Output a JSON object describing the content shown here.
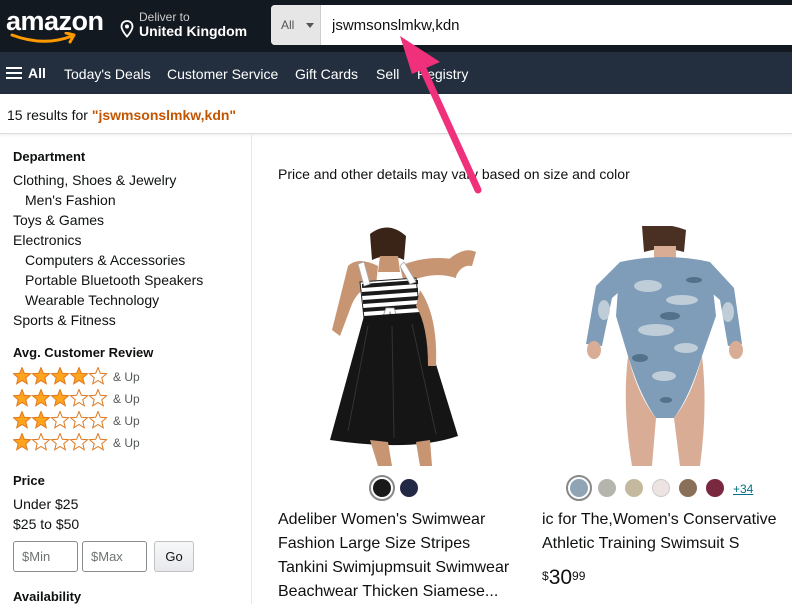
{
  "header": {
    "logo_text": "amazon",
    "deliver_to_label": "Deliver to",
    "deliver_to_location": "United Kingdom",
    "search": {
      "category": "All",
      "query": "jswmsonslmkw,kdn"
    }
  },
  "nav": {
    "all_label": "All",
    "items": [
      "Today's Deals",
      "Customer Service",
      "Gift Cards",
      "Sell",
      "Registry"
    ]
  },
  "results": {
    "prefix": "15 results for ",
    "query": "\"jswmsonslmkw,kdn\""
  },
  "sidebar": {
    "department_heading": "Department",
    "departments": [
      "Clothing, Shoes & Jewelry",
      "Men's Fashion",
      "Toys & Games",
      "Electronics",
      "Computers & Accessories",
      "Portable Bluetooth Speakers",
      "Wearable Technology",
      "Sports & Fitness"
    ],
    "review_heading": "Avg. Customer Review",
    "review_options": [
      {
        "stars": 4,
        "label": "& Up"
      },
      {
        "stars": 3,
        "label": "& Up"
      },
      {
        "stars": 2,
        "label": "& Up"
      },
      {
        "stars": 1,
        "label": "& Up"
      }
    ],
    "price_heading": "Price",
    "price_ranges": [
      "Under $25",
      "$25 to $50"
    ],
    "min_placeholder": "Min",
    "max_placeholder": "Max",
    "currency_symbol": "$",
    "go_label": "Go",
    "availability_heading": "Availability"
  },
  "main": {
    "notice": "Price and other details may vary based on size and color",
    "products": [
      {
        "title_lines": [
          "Adeliber Women's Swimwear",
          "Fashion Large Size Stripes",
          "Tankini Swimjupmsuit Swimwear",
          "Beachwear Thicken Siamese..."
        ],
        "swatches": [
          "#1a1a1a",
          "#232845"
        ],
        "selected_swatch": 0,
        "more_colors": "",
        "price_symbol": "",
        "price_whole": "",
        "price_fraction": ""
      },
      {
        "title_lines": [
          "ic for The,Women's Conservative",
          "Athletic Training Swimsuit S"
        ],
        "swatches": [
          "#8fa4b5",
          "#b5b5ae",
          "#c4b89f",
          "#ede3e3",
          "#8a7058",
          "#7a2840"
        ],
        "selected_swatch": 0,
        "more_colors": "+34",
        "price_symbol": "$",
        "price_whole": "30",
        "price_fraction": "99"
      }
    ]
  },
  "colors": {
    "header_bg": "#131921",
    "nav_bg": "#232f3e",
    "query_orange": "#c45500",
    "star_fill": "#ffa41c",
    "link_teal": "#007185",
    "annotation_arrow": "#f0307a"
  }
}
